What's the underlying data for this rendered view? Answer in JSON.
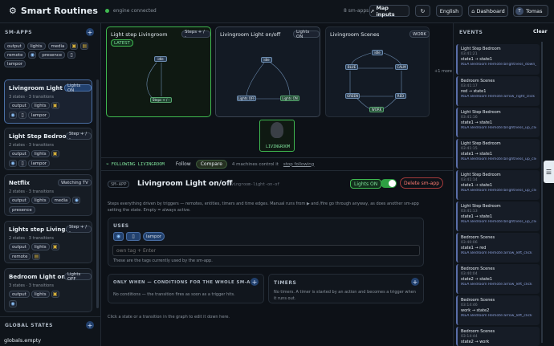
{
  "app": {
    "title": "Smart Routines",
    "status": "engine connected",
    "sm_count": "8 sm-apps",
    "map_inputs": "Map inputs",
    "language": "English",
    "dashboard": "Dashboard",
    "user_initial": "T",
    "user_name": "Tomas"
  },
  "sidebar": {
    "section_label": "SM-APPS",
    "global_tags": [
      "output",
      "lights",
      "media",
      "remote",
      "presence",
      "lampor"
    ],
    "apps": [
      {
        "name": "Livingroom Light o...",
        "badge": "Lights ON",
        "meta": "3 states · 3 transitions",
        "tags": [
          "output",
          "lights"
        ],
        "tags2": [
          "lampor"
        ]
      },
      {
        "name": "Light Step Bedroom",
        "badge": "Step + / -",
        "meta": "2 states · 3 transitions",
        "tags": [
          "output",
          "lights"
        ],
        "tags2": [
          "lampor"
        ]
      },
      {
        "name": "Netflix",
        "badge": "Watching TV",
        "meta": "2 states · 3 transitions",
        "tags": [
          "output",
          "lights",
          "media"
        ],
        "tags2": [
          "presence"
        ]
      },
      {
        "name": "Lights step Livingr...",
        "badge": "Step + / -",
        "meta": "2 states · 3 transitions",
        "tags": [
          "output",
          "lights"
        ],
        "tags2": [
          "remote"
        ]
      },
      {
        "name": "Bedroom Light on/...",
        "badge": "Lights OFF",
        "meta": "3 states · 3 transitions",
        "tags": [
          "output",
          "lights"
        ],
        "tags2": []
      }
    ],
    "global_states_label": "GLOBAL STATES",
    "globals_value": "globals.empty"
  },
  "machines": [
    {
      "title": "Light step Livingroom",
      "badge": "Steps + / -",
      "latest": "LATEST",
      "nodes": [
        "idle",
        "Steps + / -"
      ]
    },
    {
      "title": "Livingroom Light on/off",
      "badge": "Lights ON",
      "nodes": [
        "idle",
        "Lights OFF",
        "Lights ON"
      ]
    },
    {
      "title": "Livingroom Scenes",
      "badge": "WORK",
      "nodes": [
        "idle",
        "BLUE",
        "CALM",
        "GREEN",
        "RED",
        "WORK"
      ]
    }
  ],
  "more_label": "+1 more",
  "device_label": "LIVINGROOM",
  "following": {
    "label": "FOLLOWING LIVINGROOM",
    "follow": "Follow",
    "compare": "Compare",
    "count": "4 machines control it",
    "stop": "stop following"
  },
  "editor": {
    "kind": "SM-APP",
    "title": "Livingroom Light on/off",
    "slug": "livingroom-light-on-of",
    "state_badge": "Lights ON",
    "delete_label": "Delete sm-app",
    "description": "Steps everything driven by triggers — remotes, entities, timers and time edges. Manual runs from ▶ and /fire go through anyway, as does another sm-app setting the state. Empty = always active.",
    "uses_label": "USES",
    "uses_tags": [
      "lampor"
    ],
    "tag_placeholder": "own tag + Enter",
    "uses_help": "These are the tags currently used by the sm-app.",
    "only_when_label": "ONLY WHEN — CONDITIONS FOR THE WHOLE SM-APP",
    "only_when_text": "No conditions — the transition fires as soon as a trigger hits.",
    "timers_label": "TIMERS",
    "timers_text": "No timers. A timer is started by an action and becomes a trigger when it runs out.",
    "footer_hint": "Click a state or a transition in the graph to edit it down here."
  },
  "events": {
    "label": "EVENTS",
    "clear": "Clear",
    "items": [
      {
        "app": "Light Step Bedroom",
        "time": "03:41:21",
        "change": "state1 → state1",
        "source": "IKEA Bedroom Remote:brightness_down_click"
      },
      {
        "app": "Bedroom Scenes",
        "time": "03:41:17",
        "change": "red → state1",
        "source": "IKEA Bedroom Remote:arrow_right_click"
      },
      {
        "app": "Light Step Bedroom",
        "time": "03:41:16",
        "change": "state1 → state1",
        "source": "IKEA Bedroom Remote:brightness_up_click"
      },
      {
        "app": "Light Step Bedroom",
        "time": "03:41:15",
        "change": "state1 → state1",
        "source": "IKEA Bedroom Remote:brightness_up_click"
      },
      {
        "app": "Light Step Bedroom",
        "time": "03:41:14",
        "change": "state1 → state1",
        "source": "IKEA Bedroom Remote:brightness_up_click"
      },
      {
        "app": "Light Step Bedroom",
        "time": "03:41:13",
        "change": "state1 → state1",
        "source": "IKEA Bedroom Remote:brightness_up_click"
      },
      {
        "app": "Bedroom Scenes",
        "time": "03:40:06",
        "change": "state1 → red",
        "source": "IKEA Bedroom Remote:arrow_left_click"
      },
      {
        "app": "Bedroom Scenes",
        "time": "03:40:04",
        "change": "state2 → state1",
        "source": "IKEA Bedroom Remote:arrow_left_click"
      },
      {
        "app": "Bedroom Scenes",
        "time": "03:14:46",
        "change": "work → state2",
        "source": "IKEA Bedroom Remote:arrow_left_click"
      },
      {
        "app": "Bedroom Scenes",
        "time": "03:14:44",
        "change": "state2 → work",
        "source": ""
      }
    ]
  },
  "colors": {
    "accent_green": "#3fb950",
    "panel": "#11161d",
    "selected_border": "#4a6fa5",
    "danger": "#f85149"
  }
}
